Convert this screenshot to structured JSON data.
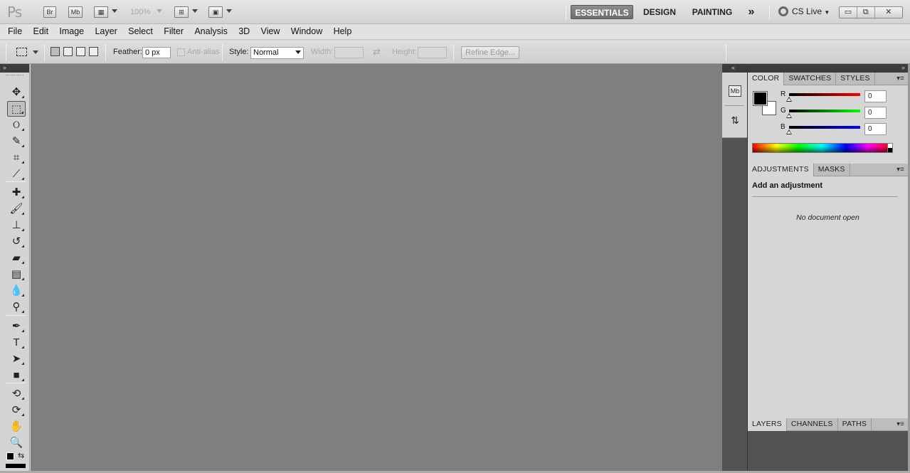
{
  "titlebar": {
    "logo": "Ps",
    "bridge": "Br",
    "minibridge": "Mb",
    "zoom": "100%",
    "workspaces": [
      "ESSENTIALS",
      "DESIGN",
      "PAINTING"
    ],
    "more": "»",
    "cslive": "CS Live",
    "window_controls": [
      "▭",
      "⧉",
      "✕"
    ]
  },
  "menu": [
    "File",
    "Edit",
    "Image",
    "Layer",
    "Select",
    "Filter",
    "Analysis",
    "3D",
    "View",
    "Window",
    "Help"
  ],
  "options": {
    "feather_label": "Feather:",
    "feather_value": "0 px",
    "antialias_label": "Anti-alias",
    "style_label": "Style:",
    "style_value": "Normal",
    "width_label": "Width:",
    "height_label": "Height:",
    "swap_icon": "⇄",
    "refine_edge": "Refine Edge..."
  },
  "toolbox": {
    "collapse": "»",
    "tools": [
      {
        "name": "move-tool",
        "glyph": "✥"
      },
      {
        "name": "rectangular-marquee-tool",
        "glyph": "⬚"
      },
      {
        "name": "lasso-tool",
        "glyph": "ଠ"
      },
      {
        "name": "quick-selection-tool",
        "glyph": "✎"
      },
      {
        "name": "crop-tool",
        "glyph": "⌗"
      },
      {
        "name": "eyedropper-tool",
        "glyph": "⟋"
      },
      {
        "name": "spot-healing-tool",
        "glyph": "✚"
      },
      {
        "name": "brush-tool",
        "glyph": "🖌"
      },
      {
        "name": "clone-stamp-tool",
        "glyph": "⊥"
      },
      {
        "name": "history-brush-tool",
        "glyph": "↺"
      },
      {
        "name": "eraser-tool",
        "glyph": "▰"
      },
      {
        "name": "gradient-tool",
        "glyph": "▤"
      },
      {
        "name": "blur-tool",
        "glyph": "💧"
      },
      {
        "name": "dodge-tool",
        "glyph": "⚲"
      },
      {
        "name": "pen-tool",
        "glyph": "✒"
      },
      {
        "name": "type-tool",
        "glyph": "T"
      },
      {
        "name": "path-selection-tool",
        "glyph": "➤"
      },
      {
        "name": "rectangle-shape-tool",
        "glyph": "■"
      },
      {
        "name": "3d-rotate-tool",
        "glyph": "⟲"
      },
      {
        "name": "3d-orbit-tool",
        "glyph": "⟳"
      },
      {
        "name": "hand-tool",
        "glyph": "✋"
      },
      {
        "name": "zoom-tool",
        "glyph": "🔍"
      }
    ]
  },
  "dock": {
    "collapse": "«",
    "icons": [
      "Mb",
      "⇅"
    ]
  },
  "panels": {
    "expand": "»",
    "color": {
      "tabs": [
        "COLOR",
        "SWATCHES",
        "STYLES"
      ],
      "channels": [
        {
          "label": "R",
          "value": "0",
          "color_from": "#000000",
          "color_to": "#ff0000"
        },
        {
          "label": "G",
          "value": "0",
          "color_from": "#000000",
          "color_to": "#00ff00"
        },
        {
          "label": "B",
          "value": "0",
          "color_from": "#000000",
          "color_to": "#0000ff"
        }
      ],
      "foreground": "#000000",
      "background": "#ffffff"
    },
    "adjustments": {
      "tabs": [
        "ADJUSTMENTS",
        "MASKS"
      ],
      "title": "Add an adjustment",
      "empty": "No document open"
    },
    "layers": {
      "tabs": [
        "LAYERS",
        "CHANNELS",
        "PATHS"
      ]
    },
    "menu_icon": "▾≡"
  }
}
